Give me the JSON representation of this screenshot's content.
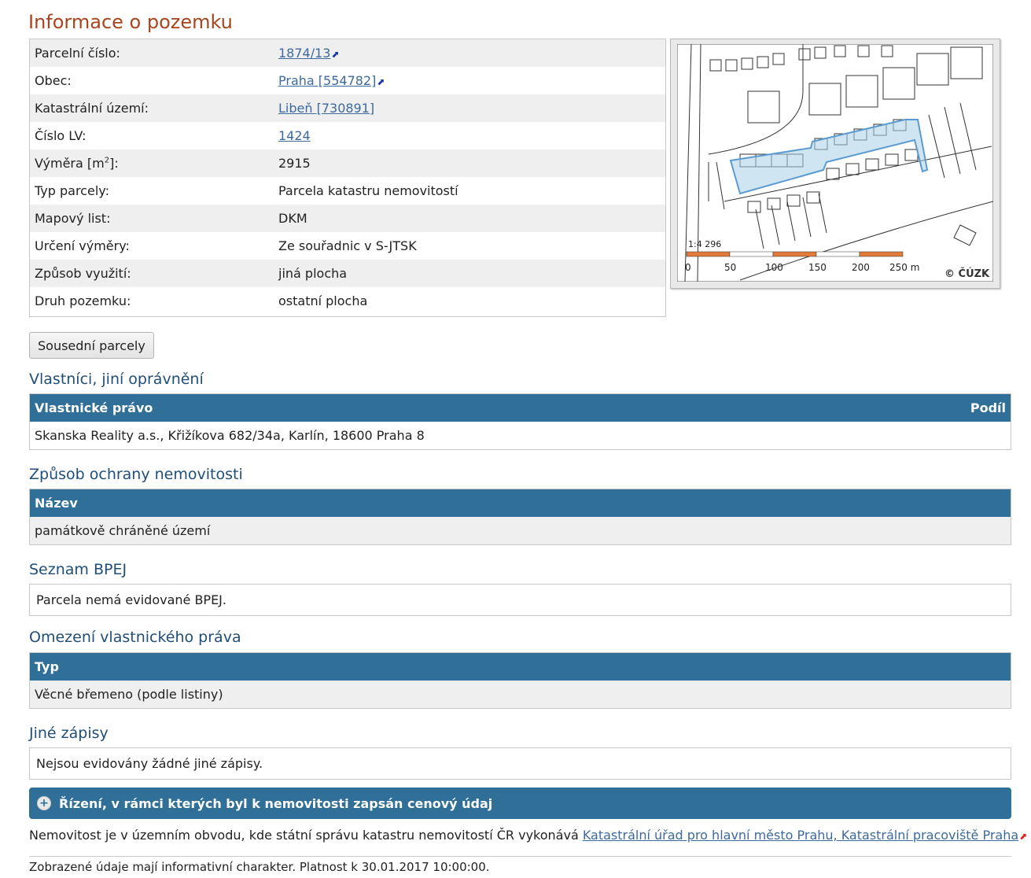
{
  "title": "Informace o pozemku",
  "info": [
    {
      "label": "Parcelní číslo:",
      "value": "1874/13",
      "link": true,
      "ext": true
    },
    {
      "label": "Obec:",
      "value": "Praha [554782]",
      "link": true,
      "ext": true
    },
    {
      "label": "Katastrální území:",
      "value": "Libeň [730891]",
      "link": true,
      "ext": false
    },
    {
      "label": "Číslo LV:",
      "value": "1424",
      "link": true,
      "ext": false
    },
    {
      "label": "Výměra [m²]:",
      "value": "2915",
      "link": false,
      "ext": false
    },
    {
      "label": "Typ parcely:",
      "value": "Parcela katastru nemovitostí",
      "link": false,
      "ext": false
    },
    {
      "label": "Mapový list:",
      "value": "DKM",
      "link": false,
      "ext": false
    },
    {
      "label": "Určení výměry:",
      "value": "Ze souřadnic v S-JTSK",
      "link": false,
      "ext": false
    },
    {
      "label": "Způsob využití:",
      "value": "jiná plocha",
      "link": false,
      "ext": false
    },
    {
      "label": "Druh pozemku:",
      "value": "ostatní plocha",
      "link": false,
      "ext": false
    }
  ],
  "area_label_base": "Výměra [m",
  "area_label_sup": "2",
  "area_label_end": "]:",
  "map": {
    "scale_ratio": "1:4 296",
    "scale_ticks": [
      "0",
      "50",
      "100",
      "150",
      "200",
      "250 m"
    ],
    "copyright": "© ČÚZK",
    "parcel_color": "#a9cfe8",
    "scale_color": "#e07b39"
  },
  "neighbors_button": "Sousední parcely",
  "owners": {
    "title": "Vlastníci, jiní oprávnění",
    "col_right": "Vlastnické právo",
    "col_share": "Podíl",
    "row": "Skanska Reality a.s., Křižíkova 682/34a, Karlín, 18600 Praha 8"
  },
  "protection": {
    "title": "Způsob ochrany nemovitosti",
    "col": "Název",
    "row": "památkově chráněné území"
  },
  "bpej": {
    "title": "Seznam BPEJ",
    "note": "Parcela nemá evidované BPEJ."
  },
  "restrictions": {
    "title": "Omezení vlastnického práva",
    "col": "Typ",
    "row": "Věcné břemeno (podle listiny)"
  },
  "other": {
    "title": "Jiné zápisy",
    "note": "Nejsou evidovány žádné jiné zápisy."
  },
  "proceedings_bar": "Řízení, v rámci kterých byl k nemovitosti zapsán cenový údaj",
  "footer": {
    "text": "Nemovitost je v územním obvodu, kde státní správu katastru nemovitostí ČR vykonává ",
    "link": "Katastrální úřad pro hlavní město Prahu, Katastrální pracoviště Praha"
  },
  "validity": "Zobrazené údaje mají informativní charakter. Platnost k 30.01.2017 10:00:00."
}
